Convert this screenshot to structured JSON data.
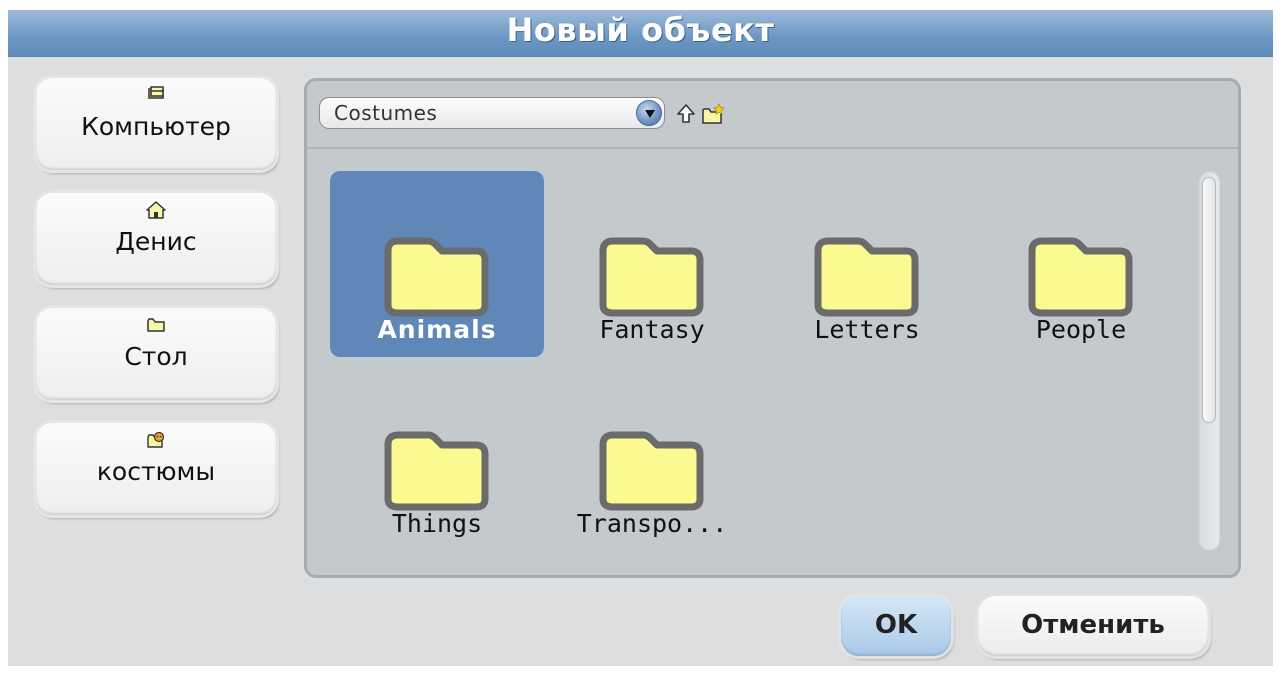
{
  "dialog": {
    "title": "Новый объект"
  },
  "sidebar": {
    "items": [
      {
        "label": "Компьютер",
        "icon": "computer-icon"
      },
      {
        "label": "Денис",
        "icon": "home-icon"
      },
      {
        "label": "Стол",
        "icon": "folder-icon"
      },
      {
        "label": "костюмы",
        "icon": "costumes-icon"
      }
    ]
  },
  "toolbar": {
    "location": "Costumes"
  },
  "folders": [
    {
      "label": "Animals",
      "selected": true
    },
    {
      "label": "Fantasy",
      "selected": false
    },
    {
      "label": "Letters",
      "selected": false
    },
    {
      "label": "People",
      "selected": false
    },
    {
      "label": "Things",
      "selected": false
    },
    {
      "label": "Transpo...",
      "selected": false
    }
  ],
  "buttons": {
    "ok": "OK",
    "cancel": "Отменить"
  },
  "colors": {
    "title_bar": "#6c96c3",
    "selection": "#5f88b8",
    "folder_fill": "#fafa90",
    "folder_outline": "#6b6b6b",
    "panel": "#c4c9ce"
  }
}
